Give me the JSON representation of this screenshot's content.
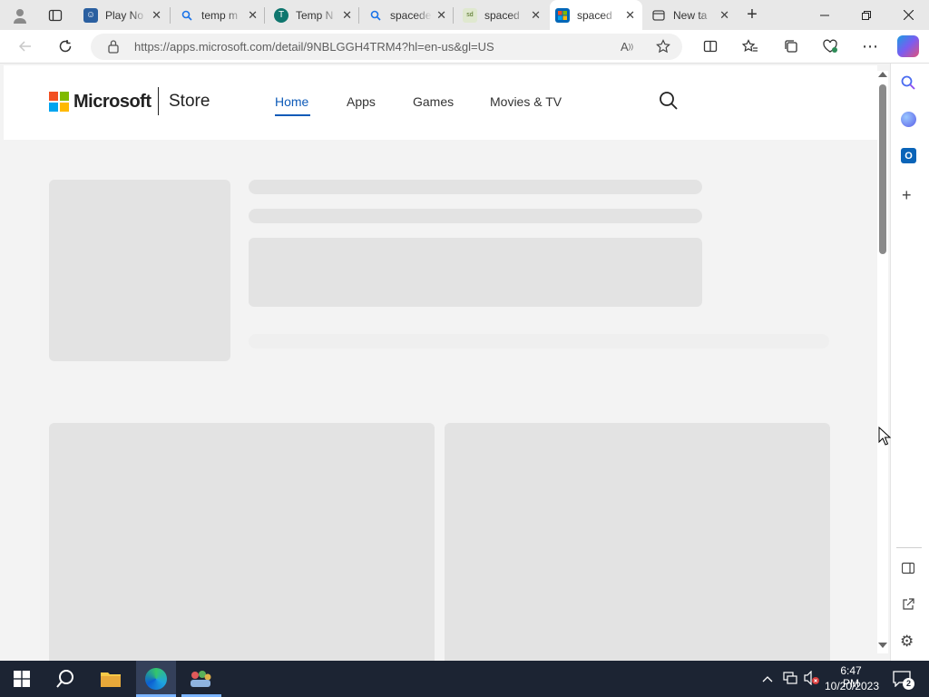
{
  "browser": {
    "tabs": [
      {
        "title": "Play No",
        "icon": "person-avatar-icon",
        "color": "#2a5fa0"
      },
      {
        "title": "temp m",
        "icon": "search-icon",
        "color": "#1a73e8"
      },
      {
        "title": "Temp N",
        "icon": "temp-site-icon",
        "color": "#0f766e"
      },
      {
        "title": "spacede",
        "icon": "search-icon",
        "color": "#1a73e8"
      },
      {
        "title": "spaced",
        "icon": "spacedesk-icon",
        "color": "#6b8e23"
      },
      {
        "title": "spaced",
        "icon": "microsoft-store-icon",
        "color": "#0067b8"
      },
      {
        "title": "New ta",
        "icon": "new-tab-icon",
        "color": "#444444"
      }
    ],
    "active_tab": 5,
    "url": "https://apps.microsoft.com/detail/9NBLGGH4TRM4?hl=en-us&gl=US"
  },
  "store": {
    "brand": "Microsoft",
    "product": "Store",
    "nav": [
      "Home",
      "Apps",
      "Games",
      "Movies & TV"
    ],
    "active_nav": "Home"
  },
  "taskbar": {
    "time": "6:47 PM",
    "date": "10/20/2023",
    "notification_count": "2"
  },
  "colors": {
    "accent": "#0f5bb8",
    "skeleton": "#e3e3e3",
    "taskbar": "#1c2433"
  }
}
